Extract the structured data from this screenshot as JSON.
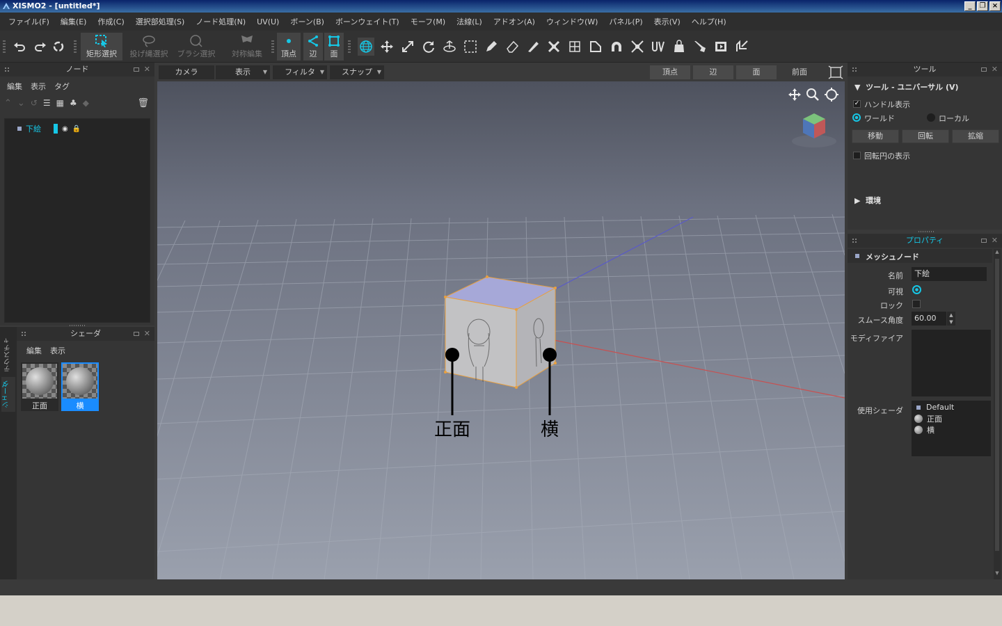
{
  "window": {
    "title": "XISMO2 - [untitled*]"
  },
  "menu": [
    "ファイル(F)",
    "編集(E)",
    "作成(C)",
    "選択部処理(S)",
    "ノード処理(N)",
    "UV(U)",
    "ボーン(B)",
    "ボーンウェイト(T)",
    "モーフ(M)",
    "法線(L)",
    "アドオン(A)",
    "ウィンドウ(W)",
    "パネル(P)",
    "表示(V)",
    "ヘルプ(H)"
  ],
  "toolbar": {
    "rect_select": "矩形選択",
    "lasso_select": "投げ縄選択",
    "brush_select": "ブラシ選択",
    "symmetry_edit": "対称編集",
    "vertex": "頂点",
    "edge": "辺",
    "face": "面"
  },
  "node_panel": {
    "title": "ノード",
    "tabs": [
      "編集",
      "表示",
      "タグ"
    ],
    "tree": [
      {
        "label": "下絵"
      }
    ]
  },
  "shader_panel": {
    "title": "シェーダ",
    "tabs": [
      "編集",
      "表示"
    ],
    "side_tabs": [
      "テクスチャ",
      "シェーダ"
    ],
    "items": [
      {
        "label": "正面"
      },
      {
        "label": "横"
      }
    ]
  },
  "viewport_bar": {
    "camera": "カメラ",
    "display": "表示",
    "filter": "フィルタ",
    "snap": "スナップ",
    "vertex": "頂点",
    "edge": "辺",
    "face": "面",
    "view": "前面"
  },
  "annotations": {
    "front": "正面",
    "side": "横"
  },
  "tool_panel": {
    "title": "ツール",
    "section": "ツール - ユニバーサル (V)",
    "handle_display": "ハンドル表示",
    "world": "ワールド",
    "local": "ローカル",
    "move": "移動",
    "rotate": "回転",
    "scale": "拡縮",
    "show_rotation_circle": "回転円の表示",
    "environment": "環境"
  },
  "properties_panel": {
    "title": "プロパティ",
    "section": "メッシュノード",
    "name_label": "名前",
    "name_value": "下絵",
    "visible_label": "可視",
    "lock_label": "ロック",
    "smooth_label": "スムース角度",
    "smooth_value": "60.00",
    "modifier_label": "モディファイア",
    "shader_label": "使用シェーダ",
    "shaders": [
      "Default",
      "正面",
      "横"
    ]
  },
  "colors": {
    "accent": "#16c7e6",
    "bg": "#2b2b2b",
    "viewport_top": "#4e525e",
    "viewport_bottom": "#9aa0ad"
  }
}
